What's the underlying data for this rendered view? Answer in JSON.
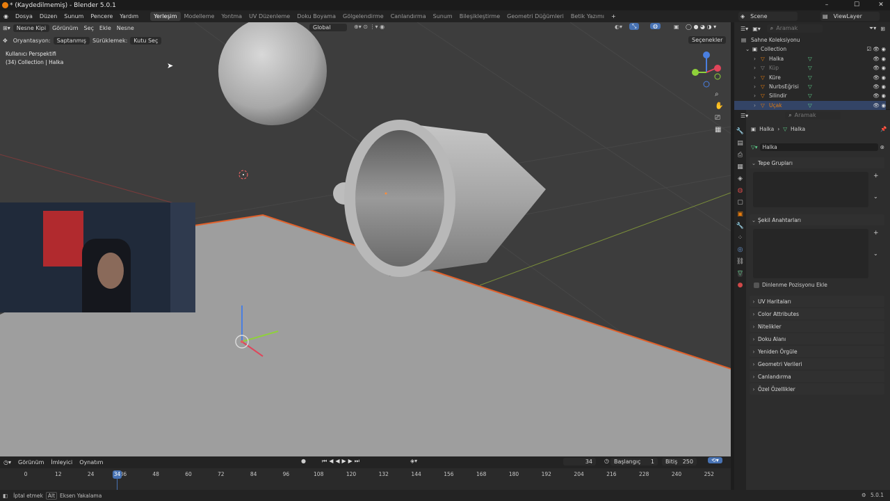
{
  "titlebar": {
    "title": "* (Kaydedilmemiş) - Blender 5.0.1",
    "minimize": "–",
    "maximize": "☐",
    "close": "✕"
  },
  "menubar": {
    "menus": [
      "Dosya",
      "Düzen",
      "Sunum",
      "Pencere",
      "Yardım"
    ],
    "workspaces": [
      "Yerleşim",
      "Modelleme",
      "Yontma",
      "UV Düzenleme",
      "Doku Boyama",
      "Gölgelendirme",
      "Canlandırma",
      "Sunum",
      "Bileşikleştirme",
      "Geometri Düğümleri",
      "Betik Yazımı"
    ],
    "active_workspace": "Yerleşim",
    "add": "+",
    "scene_label": "Scene",
    "viewlayer_label": "ViewLayer"
  },
  "viewport": {
    "mode": "Nesne Kipi",
    "menus": [
      "Görünüm",
      "Seç",
      "Ekle",
      "Nesne"
    ],
    "transform_orientation": "Global",
    "options": "Seçenekler",
    "tool_orientation_label": "Oryantasyon:",
    "tool_orientation_value": "Saptanmış",
    "tool_drag_label": "Sürüklemek:",
    "tool_drag_value": "Kutu Seç",
    "overlay_line1": "Kullanıcı Perspektifi",
    "overlay_line2": "(34) Collection | Halka"
  },
  "timeline": {
    "menus": [
      "Görünüm",
      "İmleyici",
      "Oynatım"
    ],
    "current_frame": "34",
    "start_label": "Başlangıç",
    "start_value": "1",
    "end_label": "Bitiş",
    "end_value": "250",
    "ticks": [
      "0",
      "12",
      "24",
      "36",
      "48",
      "60",
      "72",
      "84",
      "96",
      "108",
      "120",
      "132",
      "144",
      "156",
      "168",
      "180",
      "192",
      "204",
      "216",
      "228",
      "240",
      "252"
    ],
    "playhead": "34"
  },
  "statusbar": {
    "left1": "İptal etmek",
    "key": "Alt",
    "left2": "Eksen Yakalama",
    "version": "5.0.1"
  },
  "outliner": {
    "search_placeholder": "Aramak",
    "root": "Sahne Koleksiyonu",
    "collection": "Collection",
    "items": [
      {
        "name": "Halka"
      },
      {
        "name": "Küp"
      },
      {
        "name": "Küre"
      },
      {
        "name": "NurbsEğrisi"
      },
      {
        "name": "Silindir"
      },
      {
        "name": "Uçak"
      }
    ]
  },
  "properties": {
    "search_placeholder": "Aramak",
    "breadcrumb_object": "Halka",
    "breadcrumb_data": "Halka",
    "data_name": "Halka",
    "panels": [
      "Tepe Grupları",
      "Şekil Anahtarları"
    ],
    "rest_position": "Dinlenme Pozisyonu Ekle",
    "collapsed_panels": [
      "UV Haritaları",
      "Color Attributes",
      "Nitelikler",
      "Doku Alanı",
      "Yeniden Örgüle",
      "Geometri Verileri",
      "Canlandırma",
      "Özel Özellikler"
    ]
  },
  "colors": {
    "accent": "#4772b3",
    "orange": "#e87d0d",
    "data_green": "#5fd38d"
  }
}
